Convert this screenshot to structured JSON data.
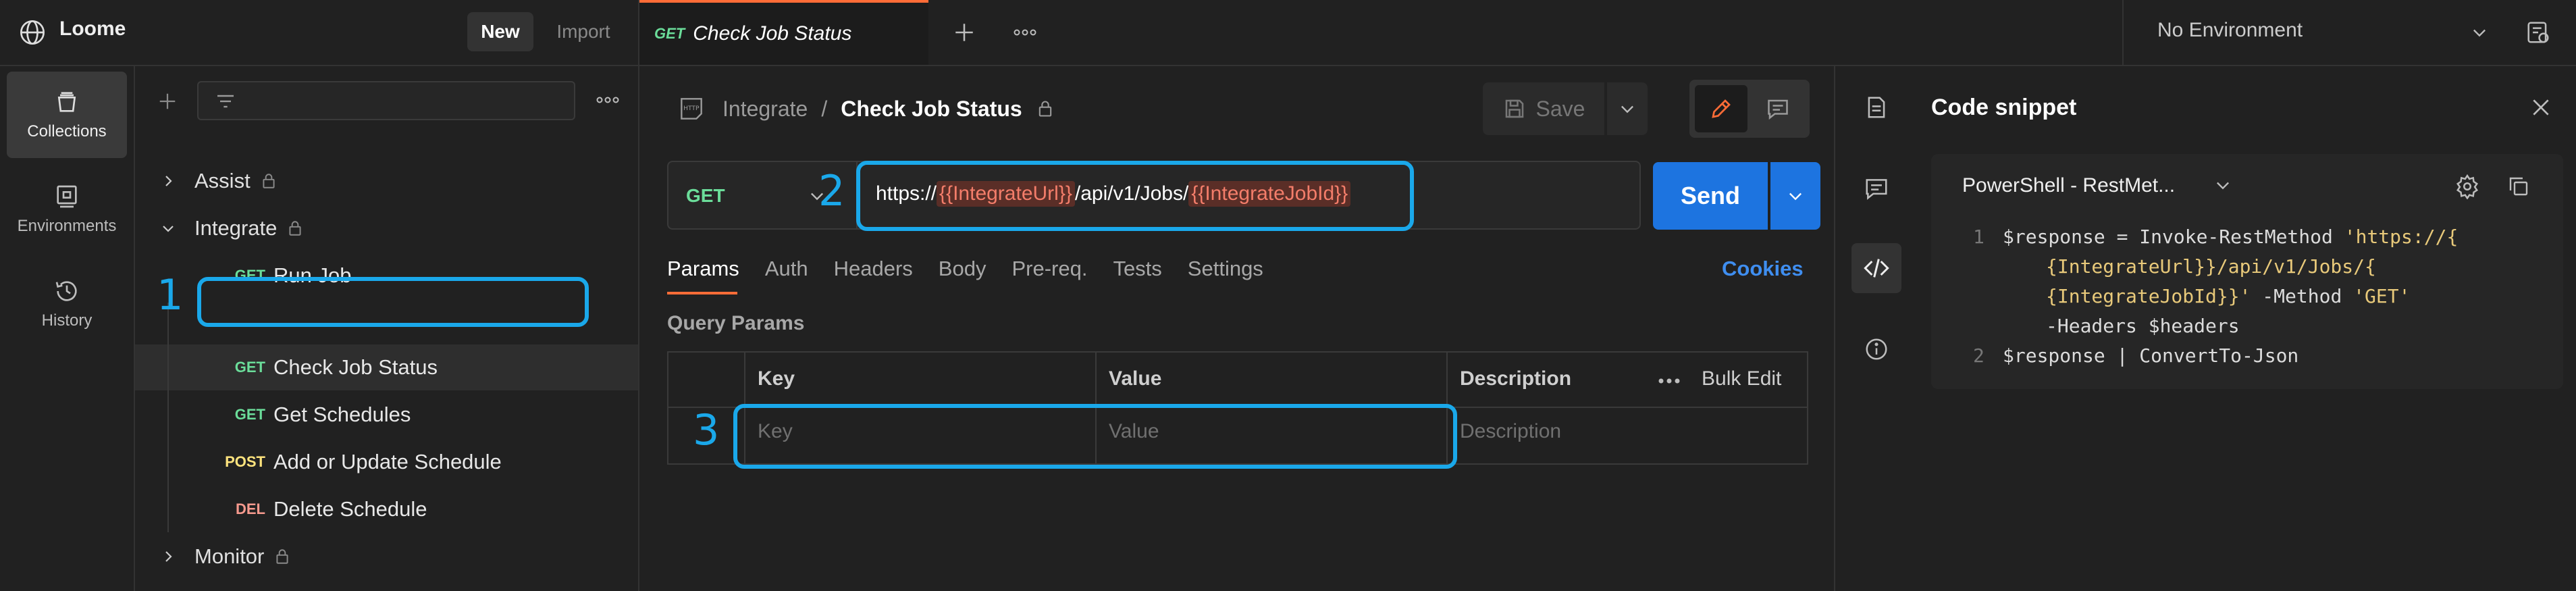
{
  "app": {
    "name": "Loome",
    "new_label": "New",
    "import_label": "Import"
  },
  "tabs": {
    "active": {
      "method": "GET",
      "title": "Check Job Status"
    }
  },
  "environment": {
    "selected": "No Environment"
  },
  "rail": {
    "items": [
      {
        "label": "Collections",
        "icon": "collections-icon"
      },
      {
        "label": "Environments",
        "icon": "environments-icon"
      },
      {
        "label": "History",
        "icon": "history-icon"
      }
    ]
  },
  "collections": {
    "folders": [
      {
        "name": "Assist",
        "expanded": false
      },
      {
        "name": "Integrate",
        "expanded": true
      },
      {
        "name": "Monitor",
        "expanded": false
      }
    ],
    "requests": [
      {
        "method": "GET",
        "name": "Run Job"
      },
      {
        "method": "GET",
        "name": "Check Job Status"
      },
      {
        "method": "GET",
        "name": "Get Schedules"
      },
      {
        "method": "POST",
        "name": "Add or Update Schedule"
      },
      {
        "method": "DEL",
        "name": "Delete Schedule"
      }
    ]
  },
  "annotations": [
    "1",
    "2",
    "3"
  ],
  "request": {
    "breadcrumb_parent": "Integrate",
    "breadcrumb_sep": "/",
    "breadcrumb_current": "Check Job Status",
    "save_label": "Save",
    "method": "GET",
    "url": {
      "prefix": "https://",
      "var1": "{{IntegrateUrl}}",
      "middle": "/api/v1/Jobs/",
      "var2": "{{IntegrateJobId}}"
    },
    "send_label": "Send",
    "tabs": [
      "Params",
      "Auth",
      "Headers",
      "Body",
      "Pre-req.",
      "Tests",
      "Settings"
    ],
    "cookies_label": "Cookies",
    "query_params_title": "Query Params",
    "columns": {
      "key": "Key",
      "value": "Value",
      "description": "Description",
      "bulk_edit": "Bulk Edit"
    },
    "placeholders": {
      "key": "Key",
      "value": "Value",
      "description": "Description"
    }
  },
  "snippet": {
    "title": "Code snippet",
    "language": "PowerShell - RestMet...",
    "lines": [
      {
        "n": "1",
        "a": "$response = Invoke-RestMethod ",
        "s": "'https://{"
      },
      {
        "n": "",
        "a": "",
        "s": "{IntegrateUrl}}/api/v1/Jobs/{"
      },
      {
        "n": "",
        "a": "",
        "s": "{IntegrateJobId}}'",
        "b": " -Method ",
        "s2": "'GET'"
      },
      {
        "n": "",
        "a": "-Headers $headers"
      },
      {
        "n": "2",
        "a": "$response | ConvertTo-Json"
      }
    ]
  },
  "colors": {
    "accent_orange": "#ff6c37",
    "send_blue": "#1d74e0",
    "annotation_blue": "#1aa8ea",
    "get_green": "#6bdd9a",
    "post_yellow": "#ffe47e",
    "delete_red": "#f79a8e"
  }
}
